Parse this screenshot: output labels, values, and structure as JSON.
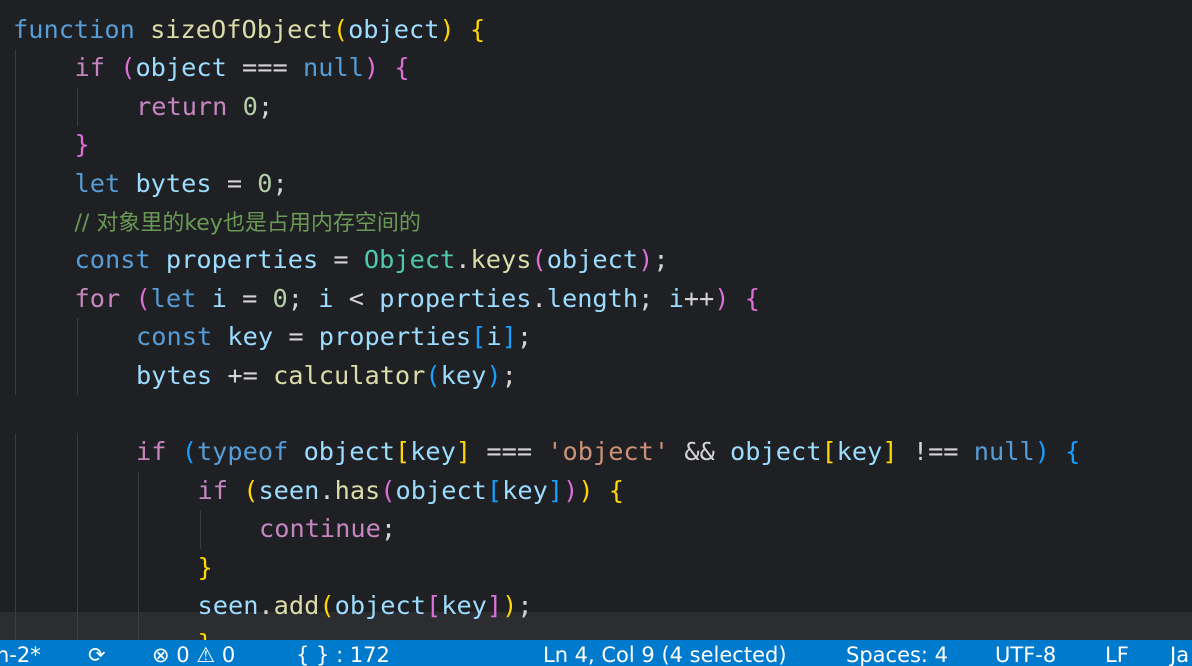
{
  "editor": {
    "language": "javascript",
    "lines": [
      {
        "indent": 0,
        "tokens": [
          {
            "t": "function",
            "c": "kwb"
          },
          {
            "t": " ",
            "c": "op"
          },
          {
            "t": "sizeOfObject",
            "c": "fn"
          },
          {
            "t": "(",
            "c": "br1"
          },
          {
            "t": "object",
            "c": "var"
          },
          {
            "t": ")",
            "c": "br1"
          },
          {
            "t": " ",
            "c": "op"
          },
          {
            "t": "{",
            "c": "br1"
          }
        ]
      },
      {
        "indent": 1,
        "tokens": [
          {
            "t": "if",
            "c": "kw"
          },
          {
            "t": " ",
            "c": "op"
          },
          {
            "t": "(",
            "c": "br2"
          },
          {
            "t": "object",
            "c": "var"
          },
          {
            "t": " === ",
            "c": "op"
          },
          {
            "t": "null",
            "c": "kwb"
          },
          {
            "t": ")",
            "c": "br2"
          },
          {
            "t": " ",
            "c": "op"
          },
          {
            "t": "{",
            "c": "br2"
          }
        ]
      },
      {
        "indent": 2,
        "tokens": [
          {
            "t": "return",
            "c": "kw"
          },
          {
            "t": " ",
            "c": "op"
          },
          {
            "t": "0",
            "c": "num"
          },
          {
            "t": ";",
            "c": "op"
          }
        ]
      },
      {
        "indent": 1,
        "tokens": [
          {
            "t": "}",
            "c": "br2"
          }
        ]
      },
      {
        "indent": 1,
        "tokens": [
          {
            "t": "let",
            "c": "kwb"
          },
          {
            "t": " ",
            "c": "op"
          },
          {
            "t": "bytes",
            "c": "var"
          },
          {
            "t": " = ",
            "c": "op"
          },
          {
            "t": "0",
            "c": "num"
          },
          {
            "t": ";",
            "c": "op"
          }
        ]
      },
      {
        "indent": 1,
        "tokens": [
          {
            "t": "// 对象里的key也是占用内存空间的",
            "c": "cmt"
          }
        ]
      },
      {
        "indent": 1,
        "tokens": [
          {
            "t": "const",
            "c": "kwb"
          },
          {
            "t": " ",
            "c": "op"
          },
          {
            "t": "properties",
            "c": "var"
          },
          {
            "t": " = ",
            "c": "op"
          },
          {
            "t": "Object",
            "c": "cls"
          },
          {
            "t": ".",
            "c": "op"
          },
          {
            "t": "keys",
            "c": "fn"
          },
          {
            "t": "(",
            "c": "br2"
          },
          {
            "t": "object",
            "c": "var"
          },
          {
            "t": ")",
            "c": "br2"
          },
          {
            "t": ";",
            "c": "op"
          }
        ]
      },
      {
        "indent": 1,
        "tokens": [
          {
            "t": "for",
            "c": "kw"
          },
          {
            "t": " ",
            "c": "op"
          },
          {
            "t": "(",
            "c": "br2"
          },
          {
            "t": "let",
            "c": "kwb"
          },
          {
            "t": " ",
            "c": "op"
          },
          {
            "t": "i",
            "c": "var"
          },
          {
            "t": " = ",
            "c": "op"
          },
          {
            "t": "0",
            "c": "num"
          },
          {
            "t": "; ",
            "c": "op"
          },
          {
            "t": "i",
            "c": "var"
          },
          {
            "t": " < ",
            "c": "op"
          },
          {
            "t": "properties",
            "c": "var"
          },
          {
            "t": ".",
            "c": "op"
          },
          {
            "t": "length",
            "c": "var"
          },
          {
            "t": "; ",
            "c": "op"
          },
          {
            "t": "i",
            "c": "var"
          },
          {
            "t": "++",
            "c": "op"
          },
          {
            "t": ")",
            "c": "br2"
          },
          {
            "t": " ",
            "c": "op"
          },
          {
            "t": "{",
            "c": "br2"
          }
        ]
      },
      {
        "indent": 2,
        "tokens": [
          {
            "t": "const",
            "c": "kwb"
          },
          {
            "t": " ",
            "c": "op"
          },
          {
            "t": "key",
            "c": "var"
          },
          {
            "t": " = ",
            "c": "op"
          },
          {
            "t": "properties",
            "c": "var"
          },
          {
            "t": "[",
            "c": "br3"
          },
          {
            "t": "i",
            "c": "var"
          },
          {
            "t": "]",
            "c": "br3"
          },
          {
            "t": ";",
            "c": "op"
          }
        ]
      },
      {
        "indent": 2,
        "tokens": [
          {
            "t": "bytes",
            "c": "var"
          },
          {
            "t": " += ",
            "c": "op"
          },
          {
            "t": "calculator",
            "c": "fn"
          },
          {
            "t": "(",
            "c": "br3"
          },
          {
            "t": "key",
            "c": "var"
          },
          {
            "t": ")",
            "c": "br3"
          },
          {
            "t": ";",
            "c": "op"
          }
        ]
      },
      {
        "indent": 0,
        "tokens": []
      },
      {
        "indent": 2,
        "tokens": [
          {
            "t": "if",
            "c": "kw"
          },
          {
            "t": " ",
            "c": "op"
          },
          {
            "t": "(",
            "c": "br3"
          },
          {
            "t": "typeof",
            "c": "kwb"
          },
          {
            "t": " ",
            "c": "op"
          },
          {
            "t": "object",
            "c": "var"
          },
          {
            "t": "[",
            "c": "br1"
          },
          {
            "t": "key",
            "c": "var"
          },
          {
            "t": "]",
            "c": "br1"
          },
          {
            "t": " === ",
            "c": "op"
          },
          {
            "t": "'object'",
            "c": "str"
          },
          {
            "t": " && ",
            "c": "op"
          },
          {
            "t": "object",
            "c": "var"
          },
          {
            "t": "[",
            "c": "br1"
          },
          {
            "t": "key",
            "c": "var"
          },
          {
            "t": "]",
            "c": "br1"
          },
          {
            "t": " !== ",
            "c": "op"
          },
          {
            "t": "null",
            "c": "kwb"
          },
          {
            "t": ")",
            "c": "br3"
          },
          {
            "t": " ",
            "c": "op"
          },
          {
            "t": "{",
            "c": "br3"
          }
        ]
      },
      {
        "indent": 3,
        "tokens": [
          {
            "t": "if",
            "c": "kw"
          },
          {
            "t": " ",
            "c": "op"
          },
          {
            "t": "(",
            "c": "br1"
          },
          {
            "t": "seen",
            "c": "var"
          },
          {
            "t": ".",
            "c": "op"
          },
          {
            "t": "has",
            "c": "fn"
          },
          {
            "t": "(",
            "c": "br2"
          },
          {
            "t": "object",
            "c": "var"
          },
          {
            "t": "[",
            "c": "br3"
          },
          {
            "t": "key",
            "c": "var"
          },
          {
            "t": "]",
            "c": "br3"
          },
          {
            "t": ")",
            "c": "br2"
          },
          {
            "t": ")",
            "c": "br1"
          },
          {
            "t": " ",
            "c": "op"
          },
          {
            "t": "{",
            "c": "br1"
          }
        ]
      },
      {
        "indent": 4,
        "tokens": [
          {
            "t": "continue",
            "c": "kw"
          },
          {
            "t": ";",
            "c": "op"
          }
        ]
      },
      {
        "indent": 3,
        "tokens": [
          {
            "t": "}",
            "c": "br1"
          }
        ]
      },
      {
        "indent": 3,
        "tokens": [
          {
            "t": "seen",
            "c": "var"
          },
          {
            "t": ".",
            "c": "op"
          },
          {
            "t": "add",
            "c": "fn"
          },
          {
            "t": "(",
            "c": "br1"
          },
          {
            "t": "object",
            "c": "var"
          },
          {
            "t": "[",
            "c": "br2"
          },
          {
            "t": "key",
            "c": "var"
          },
          {
            "t": "]",
            "c": "br2"
          },
          {
            "t": ")",
            "c": "br1"
          },
          {
            "t": ";",
            "c": "op"
          }
        ]
      },
      {
        "indent": 3,
        "tokens": [
          {
            "t": "}",
            "c": "br1"
          }
        ]
      }
    ]
  },
  "statusbar": {
    "branch": "n-2*",
    "sync_icon": "sync-icon",
    "errors": "0",
    "warnings": "0",
    "error_icon": "error-circle-icon",
    "warning_icon": "warning-triangle-icon",
    "symbols": "{ } : 172",
    "position": "Ln 4, Col 9 (4 selected)",
    "spaces": "Spaces: 4",
    "encoding": "UTF-8",
    "eol": "LF",
    "language": "Ja"
  },
  "colors": {
    "background": "#1f2023",
    "statusbar": "#007acc",
    "keyword_control": "#c586c0",
    "keyword_storage": "#569cd6",
    "function": "#dcdcaa",
    "variable": "#9cdcfe",
    "number": "#b5cea8",
    "string": "#ce9178",
    "comment": "#6a9955"
  }
}
